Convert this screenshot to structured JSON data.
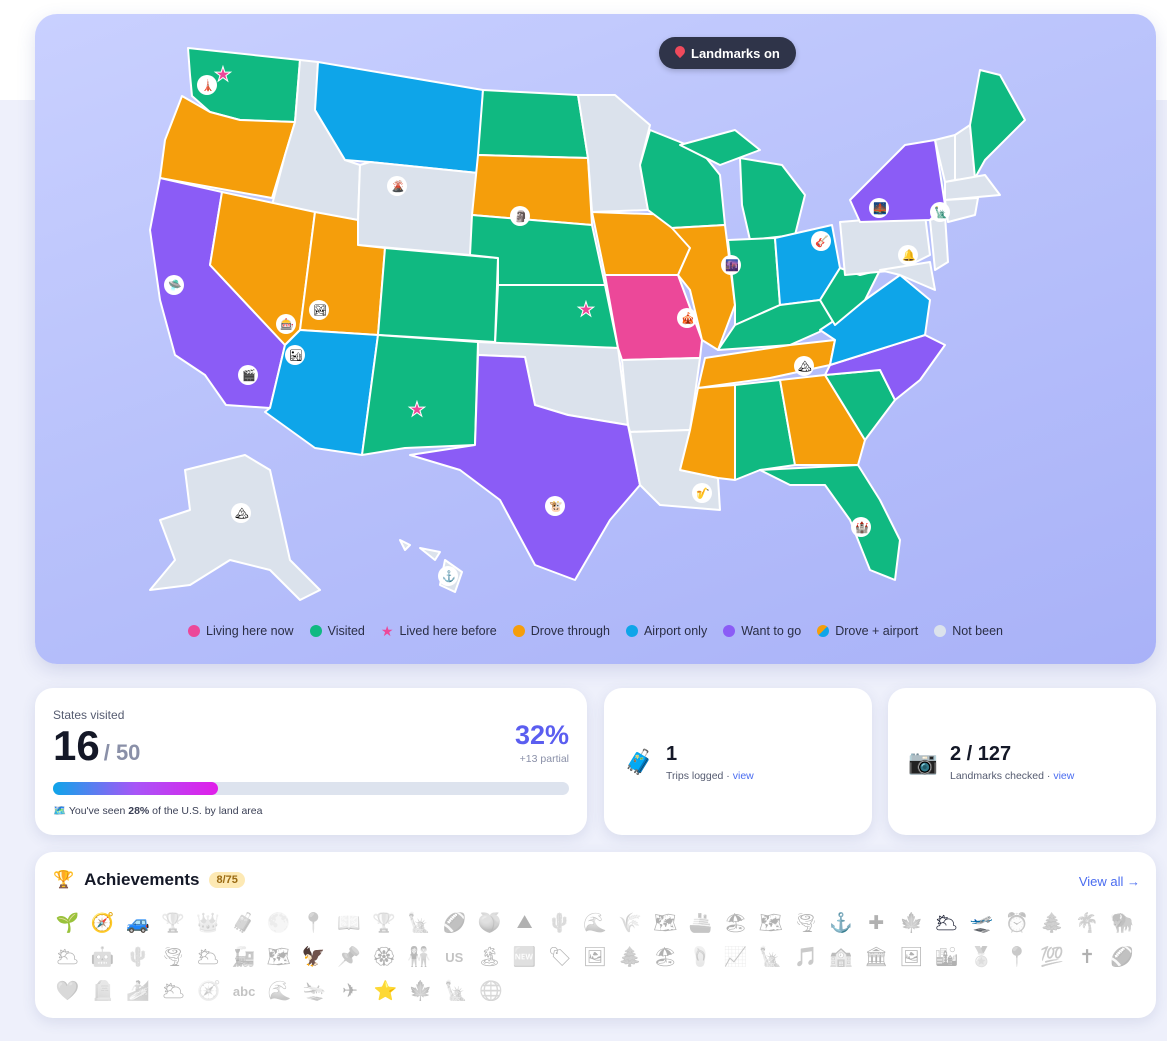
{
  "landmarks_toggle": {
    "label": "Landmarks on"
  },
  "legend": [
    {
      "label": "Living here now",
      "color": "#ec4899",
      "kind": "dot"
    },
    {
      "label": "Visited",
      "color": "#10b981",
      "kind": "dot"
    },
    {
      "label": "Lived here before",
      "color": "#ec4899",
      "kind": "star"
    },
    {
      "label": "Drove through",
      "color": "#f59e0b",
      "kind": "dot"
    },
    {
      "label": "Airport only",
      "color": "#0ea5e9",
      "kind": "dot"
    },
    {
      "label": "Want to go",
      "color": "#8b5cf6",
      "kind": "dot"
    },
    {
      "label": "Drove + airport",
      "color": "split",
      "kind": "split"
    },
    {
      "label": "Not been",
      "color": "#dbe2ec",
      "kind": "dot"
    }
  ],
  "colors": {
    "living": "#ec4899",
    "visited": "#10b981",
    "drove": "#f59e0b",
    "airport": "#0ea5e9",
    "want": "#8b5cf6",
    "notbeen": "#dbe2ec"
  },
  "stats": {
    "label": "States visited",
    "count": "16",
    "total": "/ 50",
    "percent": "32%",
    "partial": "+13 partial",
    "progress_fraction": 0.32,
    "land_prefix": "You've seen ",
    "land_pct": "28%",
    "land_suffix": " of the U.S. by land area"
  },
  "trips": {
    "count": "1",
    "label": "Trips logged · ",
    "link": "view",
    "icon": "luggage-icon"
  },
  "landmarks": {
    "count": "2 / 127",
    "label": "Landmarks checked · ",
    "link": "view",
    "icon": "camera-icon"
  },
  "achievements": {
    "title": "Achievements",
    "badge": "8/75",
    "view_all": "View all →",
    "rows": [
      [
        "🌱",
        "🧭",
        "🚙",
        "🏆",
        "👑",
        "🧳",
        "🌕",
        "📍",
        "📖",
        "🏆",
        "🗽",
        "🏈",
        "🍑",
        "⛰",
        "🌵",
        "🌊",
        "🌾",
        "🗺",
        "🚢",
        "🏖",
        "🗺",
        "🌪",
        "⚓",
        "✚",
        "🍁",
        "🌥",
        "🛫",
        "⏰",
        "🌲",
        "🌴",
        "🦬"
      ],
      [
        "🌥",
        "🤖",
        "🌵",
        "🌪",
        "🌥",
        "🚂",
        "🗺",
        "🦅",
        "📌",
        "🏵",
        "👫",
        "US",
        "🏝",
        "🆕",
        "🏷",
        "🖼",
        "🌲",
        "🏖",
        "🩴",
        "📈",
        "🗽",
        "🎵",
        "🏫",
        "🏛",
        "🖼",
        "🏙",
        "🏅",
        "📍",
        "💯",
        "✝",
        "🏈"
      ],
      [
        "🩶",
        "🪦",
        "🏄",
        "🌥",
        "🧭",
        "abc",
        "🌊",
        "🛬",
        "✈",
        "⭐",
        "🍁",
        "🗽",
        "🌐"
      ]
    ],
    "unlocked": [
      [
        0,
        1,
        2,
        22,
        25,
        26
      ],
      [
        7
      ],
      [
        9
      ]
    ]
  },
  "state_landmarks": [
    "🗼",
    "🌋",
    "🗿",
    "🛸",
    "🏞",
    "🎰",
    "🎬",
    "🏜",
    "🏔",
    "🗽",
    "🌉",
    "🔔",
    "🎸",
    "🌆",
    "🏰",
    "🎷",
    "⚓",
    "🎪",
    "🐮",
    "🏔"
  ]
}
